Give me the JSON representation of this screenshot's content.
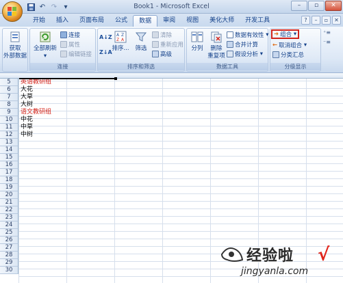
{
  "window": {
    "title": "Book1 - Microsoft Excel",
    "qat_icons": [
      "save-icon",
      "undo-icon",
      "customize-icon"
    ]
  },
  "tabs": [
    {
      "label": "开始",
      "active": false
    },
    {
      "label": "插入",
      "active": false
    },
    {
      "label": "页面布局",
      "active": false
    },
    {
      "label": "公式",
      "active": false
    },
    {
      "label": "数据",
      "active": true
    },
    {
      "label": "审阅",
      "active": false
    },
    {
      "label": "视图",
      "active": false
    },
    {
      "label": "美化大师",
      "active": false
    },
    {
      "label": "开发工具",
      "active": false
    }
  ],
  "ribbon": {
    "get_external": {
      "line1": "获取",
      "line2": "外部数据"
    },
    "connections": {
      "label": "连接",
      "refresh_all": "全部刷新",
      "connect": "连接",
      "properties": "属性",
      "edit_links": "编辑链接"
    },
    "sort_filter": {
      "label": "排序和筛选",
      "sort": "排序...",
      "filter": "筛选",
      "clear": "清除",
      "reapply": "重新应用",
      "advanced": "高级"
    },
    "data_tools": {
      "label": "数据工具",
      "text_to_columns": "分列",
      "remove_dup_line1": "删除",
      "remove_dup_line2": "重复项",
      "validation": "数据有效性",
      "consolidate": "合并计算",
      "what_if": "假设分析"
    },
    "outline": {
      "label": "分级显示",
      "group": "组合",
      "ungroup": "取消组合",
      "subtotal": "分类汇总"
    }
  },
  "sheet": {
    "rows": [
      {
        "num": "5",
        "value": "英语教研组",
        "red": true
      },
      {
        "num": "6",
        "value": "大花",
        "red": false
      },
      {
        "num": "7",
        "value": "大草",
        "red": false
      },
      {
        "num": "8",
        "value": "大树",
        "red": false
      },
      {
        "num": "9",
        "value": "语文教研组",
        "red": true
      },
      {
        "num": "10",
        "value": "中花",
        "red": false
      },
      {
        "num": "11",
        "value": "中草",
        "red": false
      },
      {
        "num": "12",
        "value": "中树",
        "red": false
      },
      {
        "num": "13",
        "value": "",
        "red": false
      },
      {
        "num": "14",
        "value": "",
        "red": false
      },
      {
        "num": "15",
        "value": "",
        "red": false
      },
      {
        "num": "16",
        "value": "",
        "red": false
      },
      {
        "num": "17",
        "value": "",
        "red": false
      },
      {
        "num": "18",
        "value": "",
        "red": false
      },
      {
        "num": "19",
        "value": "",
        "red": false
      },
      {
        "num": "20",
        "value": "",
        "red": false
      },
      {
        "num": "21",
        "value": "",
        "red": false
      },
      {
        "num": "22",
        "value": "",
        "red": false
      },
      {
        "num": "23",
        "value": "",
        "red": false
      },
      {
        "num": "24",
        "value": "",
        "red": false
      },
      {
        "num": "25",
        "value": "",
        "red": false
      },
      {
        "num": "26",
        "value": "",
        "red": false
      },
      {
        "num": "27",
        "value": "",
        "red": false
      },
      {
        "num": "28",
        "value": "",
        "red": false
      },
      {
        "num": "29",
        "value": "",
        "red": false
      },
      {
        "num": "30",
        "value": "",
        "red": false
      }
    ]
  },
  "watermark": {
    "title": "经验啦",
    "check": "√",
    "url": "jingyanla.com"
  },
  "colors": {
    "accent_red": "#d4241a",
    "highlight": "#d0221b"
  }
}
